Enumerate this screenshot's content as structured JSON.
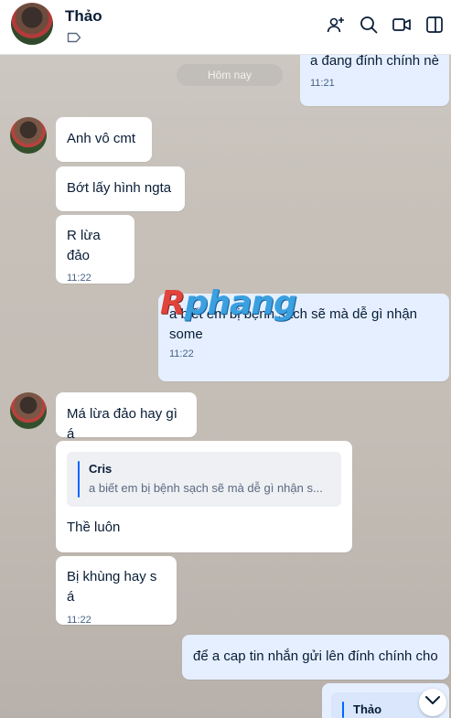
{
  "header": {
    "contact_name": "Thảo",
    "icons": [
      "add-member-icon",
      "search-icon",
      "video-call-icon",
      "sidebar-toggle-icon"
    ]
  },
  "date_separator": "Hôm nay",
  "messages": [
    {
      "id": "m0",
      "from": "me",
      "text": "a đang đính chính nè",
      "time": "11:21"
    },
    {
      "id": "m1",
      "from": "contact",
      "text": "Anh vô cmt"
    },
    {
      "id": "m2",
      "from": "contact",
      "text": "Bớt lấy hình ngta"
    },
    {
      "id": "m3",
      "from": "contact",
      "text": "R lừa đảo",
      "time": "11:22"
    },
    {
      "id": "m4",
      "from": "me",
      "text_line1": "a biết em bị bệnh sạch sẽ mà dễ gì nhận",
      "text_line2": "some",
      "time": "11:22"
    },
    {
      "id": "m5",
      "from": "contact",
      "text": "Má lừa đảo hay gì á"
    },
    {
      "id": "m6",
      "from": "contact",
      "quote_name": "Cris",
      "quote_text": "a biết em bị bệnh sạch sẽ mà dễ gì nhận s...",
      "text": "Thề luôn"
    },
    {
      "id": "m7",
      "from": "contact",
      "text": "Bị khùng hay s á",
      "time": "11:22"
    },
    {
      "id": "m8",
      "from": "me",
      "text": "để a cap tin nhắn gửi lên đính chính cho"
    },
    {
      "id": "m9",
      "from": "me",
      "quote_name": "Thảo"
    }
  ],
  "watermark": {
    "first": "R",
    "rest": "phang"
  },
  "colors": {
    "header_bg": "#ffffff",
    "my_bubble": "#e5efff",
    "their_bubble": "#ffffff",
    "accent": "#0068ff",
    "time_text": "#476285"
  }
}
